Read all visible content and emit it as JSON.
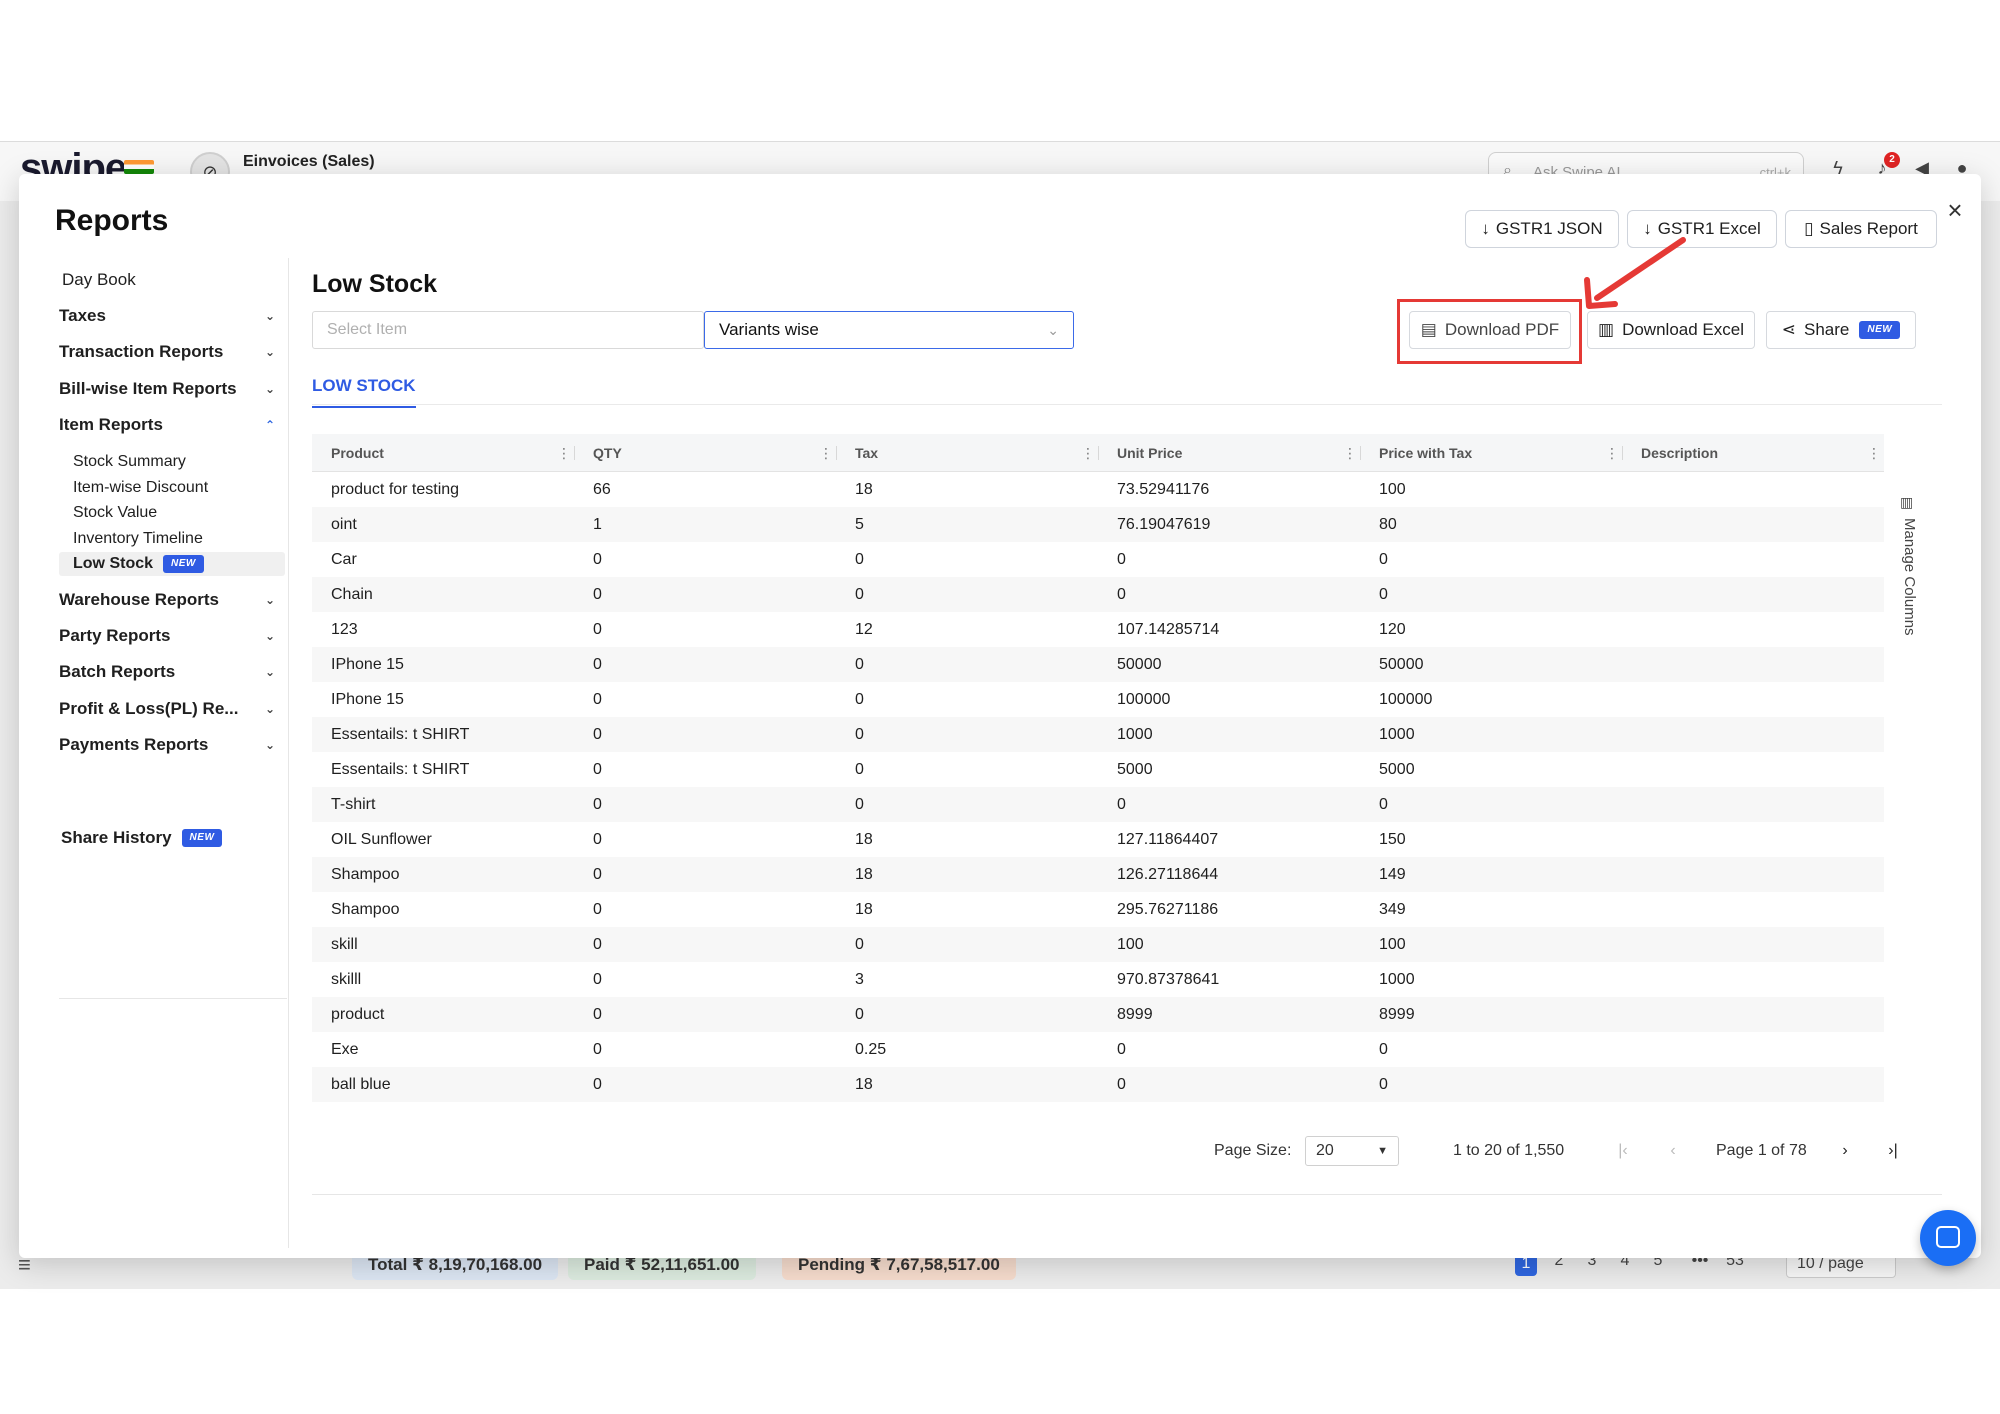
{
  "background": {
    "logo": "swipe",
    "company": "Einvoices (Sales)",
    "search_placeholder": "Ask Swipe AI",
    "search_shortcut": "ctrl+k",
    "notification_count": "2",
    "footer": {
      "total": "Total  ₹ 8,19,70,168.00",
      "paid": "Paid  ₹ 52,11,651.00",
      "pending": "Pending  ₹ 7,67,58,517.00",
      "pages": [
        "1",
        "2",
        "3",
        "4",
        "5",
        "•••",
        "53"
      ],
      "page_size": "10 / page"
    }
  },
  "modal": {
    "title": "Reports",
    "close": "×",
    "top_buttons": {
      "gstr1_json": "GSTR1 JSON",
      "gstr1_excel": "GSTR1 Excel",
      "sales_report": "Sales Report"
    }
  },
  "sidebar": {
    "day_book": "Day Book",
    "taxes": "Taxes",
    "transaction_reports": "Transaction Reports",
    "bill_wise": "Bill-wise Item Reports",
    "item_reports": "Item Reports",
    "item_sub": {
      "stock_summary": "Stock Summary",
      "item_discount": "Item-wise Discount",
      "stock_value": "Stock Value",
      "inventory_timeline": "Inventory Timeline",
      "low_stock": "Low Stock"
    },
    "warehouse": "Warehouse Reports",
    "party": "Party Reports",
    "batch": "Batch Reports",
    "profit_loss": "Profit & Loss(PL) Re...",
    "payments": "Payments Reports",
    "share_history": "Share History",
    "new_badge": "NEW"
  },
  "content": {
    "title": "Low Stock",
    "select_placeholder": "Select Item",
    "variants": "Variants wise",
    "download_pdf": "Download PDF",
    "download_excel": "Download Excel",
    "share": "Share",
    "tab": "LOW STOCK",
    "manage_columns": "Manage Columns"
  },
  "table": {
    "headers": [
      "Product",
      "QTY",
      "Tax",
      "Unit Price",
      "Price with Tax",
      "Description"
    ],
    "rows": [
      [
        "product for testing",
        "66",
        "18",
        "73.52941176",
        "100",
        ""
      ],
      [
        "oint",
        "1",
        "5",
        "76.19047619",
        "80",
        ""
      ],
      [
        "Car",
        "0",
        "0",
        "0",
        "0",
        ""
      ],
      [
        "Chain",
        "0",
        "0",
        "0",
        "0",
        ""
      ],
      [
        "123",
        "0",
        "12",
        "107.14285714",
        "120",
        ""
      ],
      [
        "IPhone 15",
        "0",
        "0",
        "50000",
        "50000",
        ""
      ],
      [
        "IPhone 15",
        "0",
        "0",
        "100000",
        "100000",
        ""
      ],
      [
        "Essentails: t SHIRT",
        "0",
        "0",
        "1000",
        "1000",
        ""
      ],
      [
        "Essentails: t SHIRT",
        "0",
        "0",
        "5000",
        "5000",
        ""
      ],
      [
        "T-shirt",
        "0",
        "0",
        "0",
        "0",
        ""
      ],
      [
        "OIL Sunflower",
        "0",
        "18",
        "127.11864407",
        "150",
        ""
      ],
      [
        "Shampoo",
        "0",
        "18",
        "126.27118644",
        "149",
        ""
      ],
      [
        "Shampoo",
        "0",
        "18",
        "295.76271186",
        "349",
        ""
      ],
      [
        "skill",
        "0",
        "0",
        "100",
        "100",
        ""
      ],
      [
        "skilll",
        "0",
        "3",
        "970.87378641",
        "1000",
        ""
      ],
      [
        "product",
        "0",
        "0",
        "8999",
        "8999",
        ""
      ],
      [
        "Exe",
        "0",
        "0.25",
        "0",
        "0",
        ""
      ],
      [
        "ball blue",
        "0",
        "18",
        "0",
        "0",
        ""
      ]
    ]
  },
  "pagination": {
    "page_size_label": "Page Size:",
    "page_size": "20",
    "range": "1 to 20 of 1,550",
    "page": "Page 1 of 78"
  },
  "colors": {
    "accent": "#2f5be3",
    "highlight": "#e53935"
  }
}
